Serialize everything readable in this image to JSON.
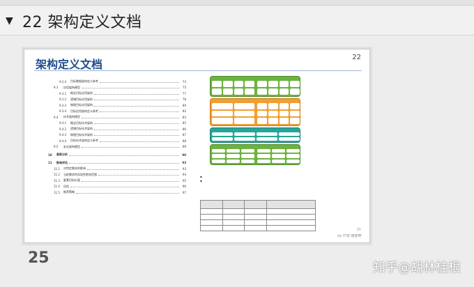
{
  "header": {
    "title": "22 架构定义文档"
  },
  "slide": {
    "title": "架构定义文档",
    "number": "22",
    "toc": [
      {
        "level": 3,
        "num": "9.2.4",
        "text": "目标数据架构定义参考",
        "page": "73"
      },
      {
        "level": 2,
        "num": "9.3",
        "text": "应用架构模型",
        "page": "75"
      },
      {
        "level": 3,
        "num": "9.3.1",
        "text": "概念目标应用架构",
        "page": "77"
      },
      {
        "level": 3,
        "num": "9.3.2",
        "text": "逻辑目标应用架构",
        "page": "78"
      },
      {
        "level": 3,
        "num": "9.3.3",
        "text": "物理目标应用架构",
        "page": "80"
      },
      {
        "level": 3,
        "num": "9.3.4",
        "text": "目标应用架构定义参考",
        "page": "82"
      },
      {
        "level": 2,
        "num": "9.4",
        "text": "技术架构模型",
        "page": "83"
      },
      {
        "level": 3,
        "num": "9.4.1",
        "text": "概念目标技术架构",
        "page": "85"
      },
      {
        "level": 3,
        "num": "9.4.2",
        "text": "逻辑目标技术架构",
        "page": "86"
      },
      {
        "level": 3,
        "num": "9.4.3",
        "text": "物理目标技术架构",
        "page": "87"
      },
      {
        "level": 3,
        "num": "9.4.4",
        "text": "目标技术架构定义参考",
        "page": "88"
      },
      {
        "level": 2,
        "num": "9.5",
        "text": "安全架构模型",
        "page": "89"
      },
      {
        "level": 1,
        "num": "10",
        "text": "差距分析",
        "page": "90"
      },
      {
        "level": 1,
        "num": "11",
        "text": "影响评估",
        "page": "93"
      },
      {
        "level": 2,
        "num": "11.1",
        "text": "对特定需求的影响",
        "page": "93"
      },
      {
        "level": 2,
        "num": "11.2",
        "text": "当前需求的实现性影响范围",
        "page": "94"
      },
      {
        "level": 2,
        "num": "11.3",
        "text": "要素目标价值",
        "page": "95"
      },
      {
        "level": 2,
        "num": "11.4",
        "text": "风险",
        "page": "96"
      },
      {
        "level": 2,
        "num": "11.5",
        "text": "推荐策略",
        "page": "97"
      }
    ],
    "layers": [
      {
        "color": "#6db33f",
        "border": "#4e8a2a"
      },
      {
        "color": "#f0a033",
        "border": "#c7791a"
      },
      {
        "color": "#26a69a",
        "border": "#1a7d74"
      },
      {
        "color": "#6db33f",
        "border": "#4e8a2a"
      }
    ],
    "footer_num": "25",
    "footer_brand": "by IT经 理宝明"
  },
  "page_number": "25",
  "watermark": "知乎@胡林桂根"
}
